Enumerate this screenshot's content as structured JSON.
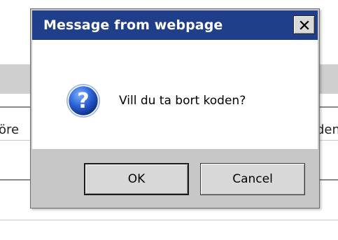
{
  "background_page": {
    "left_fragment_text": "öre",
    "right_fragment_text": "den"
  },
  "dialog": {
    "title": "Message from webpage",
    "close_icon": "close-icon",
    "message_icon": "question-icon",
    "message": "Vill du ta bort koden?",
    "buttons": {
      "ok_label": "OK",
      "cancel_label": "Cancel"
    }
  },
  "colors": {
    "titlebar": "#1f3f8a",
    "dialog_face": "#c7c7c7",
    "icon_blue": "#1e56c8"
  }
}
